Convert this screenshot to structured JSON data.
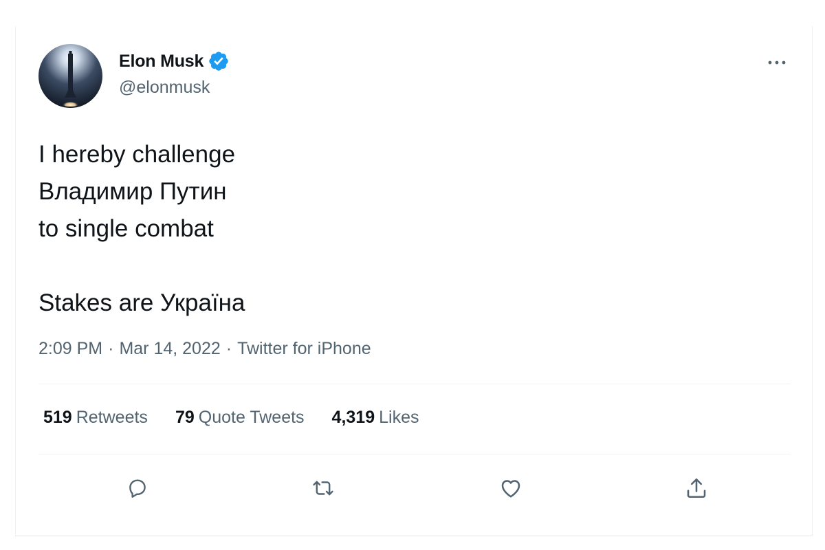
{
  "author": {
    "name": "Elon Musk",
    "handle": "@elonmusk",
    "verified": true,
    "avatar": "rocket-launch-avatar"
  },
  "tweet": {
    "text": "I hereby challenge\nВладимир Путин\nto single combat\n\nStakes are Україна",
    "time": "2:09 PM",
    "date": "Mar 14, 2022",
    "source": "Twitter for iPhone",
    "separator": "·"
  },
  "stats": {
    "retweets": {
      "count": "519",
      "label": "Retweets"
    },
    "quote_tweets": {
      "count": "79",
      "label": "Quote Tweets"
    },
    "likes": {
      "count": "4,319",
      "label": "Likes"
    }
  },
  "icons": {
    "reply": "reply-icon",
    "retweet": "retweet-icon",
    "like": "heart-icon",
    "share": "share-icon",
    "more": "more-options-icon",
    "verified": "verified-badge-icon"
  },
  "colors": {
    "text": "#0f1419",
    "secondary": "#536471",
    "verified": "#1d9bf0"
  }
}
